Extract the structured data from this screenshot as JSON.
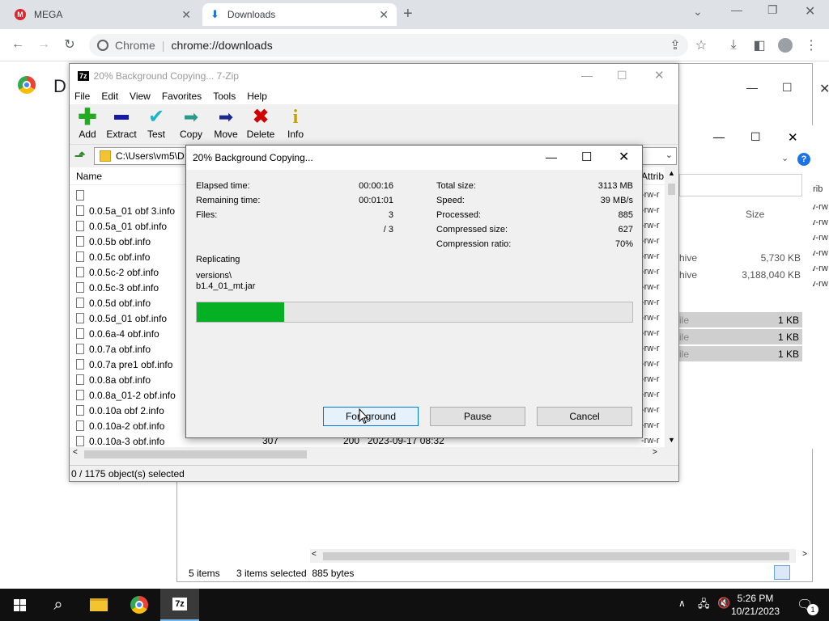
{
  "browser": {
    "tabs": [
      {
        "label": "MEGA",
        "active": false
      },
      {
        "label": "Downloads",
        "active": true
      }
    ],
    "omnibox_site": "Chrome",
    "omnibox_url": "chrome://downloads",
    "page_heading_partial": "D"
  },
  "explorer": {
    "status_items": "5 items",
    "status_selected": "3 items selected  885 bytes",
    "column_size": "Size",
    "column_attrib_partial": "ttrib",
    "rows": [
      {
        "type": "hive",
        "size": "5,730 KB"
      },
      {
        "type": "hive",
        "size": "3,188,040 KB"
      },
      {
        "type": "ile",
        "size": "1 KB"
      },
      {
        "type": "ile",
        "size": "1 KB"
      },
      {
        "type": "ile",
        "size": "1 KB"
      }
    ]
  },
  "zip": {
    "title": "20% Background Copying... 7-Zip",
    "menu": [
      "File",
      "Edit",
      "View",
      "Favorites",
      "Tools",
      "Help"
    ],
    "tools": [
      {
        "label": "Add",
        "icon": "plus-icon",
        "color": "#22aa22"
      },
      {
        "label": "Extract",
        "icon": "minus-icon",
        "color": "#1a1aa0"
      },
      {
        "label": "Test",
        "icon": "check-icon",
        "color": "#19b5c8"
      },
      {
        "label": "Copy",
        "icon": "copy-arrow-icon",
        "color": "#2a9a8a"
      },
      {
        "label": "Move",
        "icon": "move-arrow-icon",
        "color": "#1a2a90"
      },
      {
        "label": "Delete",
        "icon": "delete-x-icon",
        "color": "#d00000"
      },
      {
        "label": "Info",
        "icon": "info-icon",
        "color": "#c8a000"
      }
    ],
    "path": "C:\\Users\\vm5\\D",
    "col_name": "Name",
    "col_attrib": "Attrib",
    "files": [
      {
        "name": "",
        "attr": "-rw-r"
      },
      {
        "name": "0.0.5a_01 obf 3.info",
        "attr": "-rw-r"
      },
      {
        "name": "0.0.5a_01 obf.info",
        "attr": "-rw-r"
      },
      {
        "name": "0.0.5b obf.info",
        "attr": "-rw-r"
      },
      {
        "name": "0.0.5c obf.info",
        "attr": "-rw-r"
      },
      {
        "name": "0.0.5c-2 obf.info",
        "attr": "-rw-r"
      },
      {
        "name": "0.0.5c-3 obf.info",
        "attr": "-rw-r"
      },
      {
        "name": "0.0.5d obf.info",
        "attr": "-rw-r"
      },
      {
        "name": "0.0.5d_01 obf.info",
        "attr": "-rw-r"
      },
      {
        "name": "0.0.6a-4 obf.info",
        "attr": "-rw-r"
      },
      {
        "name": "0.0.7a obf.info",
        "attr": "-rw-r"
      },
      {
        "name": "0.0.7a pre1 obf.info",
        "attr": "-rw-r"
      },
      {
        "name": "0.0.8a obf.info",
        "attr": "-rw-r"
      },
      {
        "name": "0.0.8a_01-2 obf.info",
        "attr": "-rw-r"
      },
      {
        "name": "0.0.10a obf 2.info",
        "attr": "-rw-r"
      },
      {
        "name": "0.0.10a-2 obf.info",
        "attr": "-rw-r"
      },
      {
        "name": "0.0.10a-3 obf.info",
        "attr": "-rw-r"
      }
    ],
    "last_row_size": "307",
    "last_row_packed": "200",
    "last_row_date": "2023-09-17 08:32",
    "status": "0 / 1175 object(s) selected"
  },
  "dialog": {
    "title": "20% Background Copying...",
    "elapsed_label": "Elapsed time:",
    "elapsed": "00:00:16",
    "remaining_label": "Remaining time:",
    "remaining": "00:01:01",
    "files_label": "Files:",
    "files": "3",
    "files_total": "/ 3",
    "total_size_label": "Total size:",
    "total_size": "3113 MB",
    "speed_label": "Speed:",
    "speed": "39 MB/s",
    "processed_label": "Processed:",
    "processed": "885",
    "compressed_label": "Compressed size:",
    "compressed": "627",
    "ratio_label": "Compression ratio:",
    "ratio": "70%",
    "operation": "Replicating",
    "current_path": "versions\\",
    "current_file": "b1.4_01_mt.jar",
    "progress_fraction": 0.2,
    "progress_color": "#06b025",
    "btn_foreground": "Foreground",
    "btn_pause": "Pause",
    "btn_cancel": "Cancel"
  },
  "taskbar": {
    "time": "5:26 PM",
    "date": "10/21/2023",
    "notification_count": "1"
  }
}
